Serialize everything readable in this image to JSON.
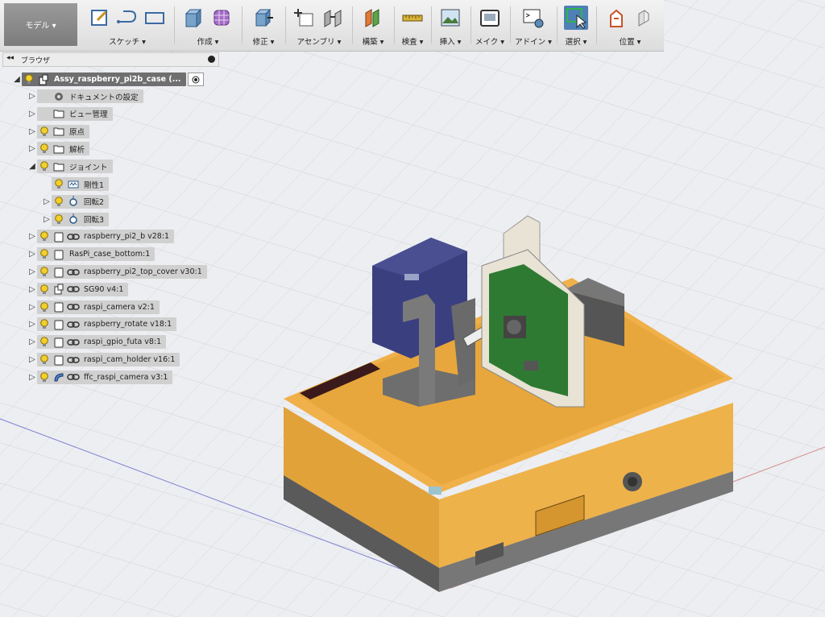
{
  "toolbar": {
    "mode_label": "モデル ▾",
    "groups": [
      {
        "label": "スケッチ ▾"
      },
      {
        "label": "作成 ▾"
      },
      {
        "label": "修正 ▾"
      },
      {
        "label": "アセンブリ ▾"
      },
      {
        "label": "構築 ▾"
      },
      {
        "label": "検査 ▾"
      },
      {
        "label": "挿入 ▾"
      },
      {
        "label": "メイク ▾"
      },
      {
        "label": "アドイン ▾"
      },
      {
        "label": "選択 ▾"
      },
      {
        "label": "位置 ▾"
      }
    ]
  },
  "browser": {
    "title": "ブラウザ",
    "collapse_glyph": "◂◂",
    "root": {
      "label": "Assy_raspberry_pi2b_case (..."
    },
    "items": [
      {
        "label": "ドキュメントの設定"
      },
      {
        "label": "ビュー管理"
      },
      {
        "label": "原点"
      },
      {
        "label": "解析"
      },
      {
        "label": "ジョイント"
      },
      {
        "label": "剛性1"
      },
      {
        "label": "回転2"
      },
      {
        "label": "回転3"
      },
      {
        "label": "raspberry_pi2_b v28:1"
      },
      {
        "label": "RasPi_case_bottom:1"
      },
      {
        "label": "raspberry_pi2_top_cover v30:1"
      },
      {
        "label": "SG90 v4:1"
      },
      {
        "label": "raspi_camera v2:1"
      },
      {
        "label": "raspberry_rotate v18:1"
      },
      {
        "label": "raspi_gpio_futa v8:1"
      },
      {
        "label": "raspi_cam_holder v16:1"
      },
      {
        "label": "ffc_raspi_camera v3:1"
      }
    ]
  },
  "colors": {
    "case_orange": "#e8a73c",
    "case_base": "#6b6b6b",
    "servo_blue": "#3a3f7f",
    "pcb_green": "#2f7a32",
    "holder_cream": "#e8e3d4",
    "select_blue": "#4e7fb6"
  }
}
